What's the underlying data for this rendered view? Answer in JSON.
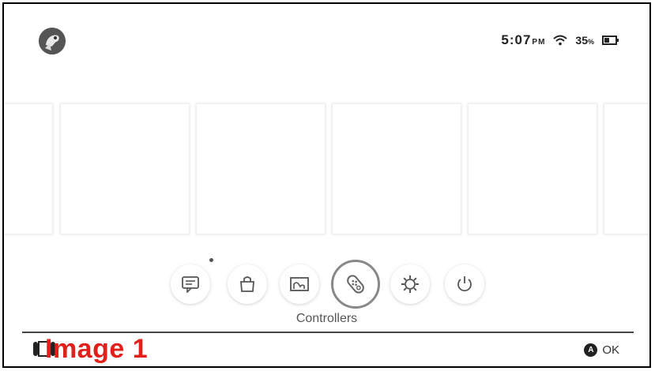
{
  "status": {
    "time": "5:07",
    "ampm": "PM",
    "battery_pct": "35",
    "battery_unit": "%"
  },
  "dock": {
    "items": [
      {
        "name": "news",
        "icon": "news-icon"
      },
      {
        "name": "shop",
        "icon": "shopping-bag-icon"
      },
      {
        "name": "album",
        "icon": "album-icon"
      },
      {
        "name": "controllers",
        "icon": "joycon-icon"
      },
      {
        "name": "settings",
        "icon": "gear-icon"
      },
      {
        "name": "power",
        "icon": "power-icon"
      }
    ],
    "selected_label": "Controllers"
  },
  "footer": {
    "overlay_text": "Image 1",
    "ok_button_letter": "A",
    "ok_label": "OK"
  },
  "colors": {
    "overlay_red": "#e0201b",
    "selected_ring": "#888888"
  }
}
